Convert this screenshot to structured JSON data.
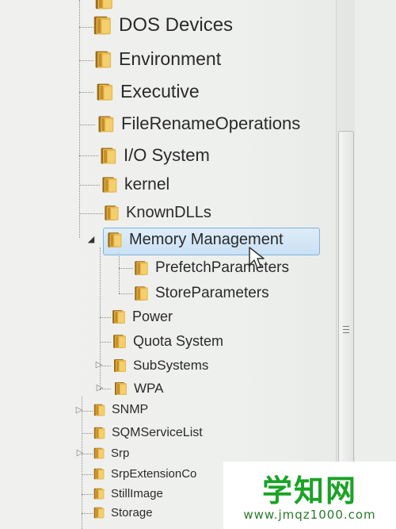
{
  "tree": {
    "top_partial_label": "",
    "items": [
      {
        "label": "DOS Devices"
      },
      {
        "label": "Environment"
      },
      {
        "label": "Executive"
      },
      {
        "label": "FileRenameOperations"
      },
      {
        "label": "I/O System"
      },
      {
        "label": "kernel"
      },
      {
        "label": "KnownDLLs"
      },
      {
        "label": "Memory Management",
        "selected": true,
        "expanded": true
      },
      {
        "label": "PrefetchParameters"
      },
      {
        "label": "StoreParameters"
      },
      {
        "label": "Power"
      },
      {
        "label": "Quota System"
      },
      {
        "label": "SubSystems",
        "collapsed": true
      },
      {
        "label": "WPA",
        "collapsed": true
      },
      {
        "label": "SNMP",
        "collapsed": true
      },
      {
        "label": "SQMServiceList"
      },
      {
        "label": "Srp",
        "collapsed": true
      },
      {
        "label": "SrpExtensionCo"
      },
      {
        "label": "StillImage"
      },
      {
        "label": "Storage"
      }
    ]
  },
  "watermark": {
    "title": "学知网",
    "url": "www.jmqz1000.com"
  },
  "icons": {
    "folder": "folder-icon",
    "expand": "triangle-right-icon",
    "collapse": "triangle-down-icon",
    "scroll_grip": "grip-icon",
    "cursor": "pointer-cursor-icon"
  },
  "colors": {
    "folder_fill": "#e8b84a",
    "folder_dark": "#9b6b1a",
    "selection_border": "#7fb4dd",
    "watermark_green": "#1aa326"
  }
}
